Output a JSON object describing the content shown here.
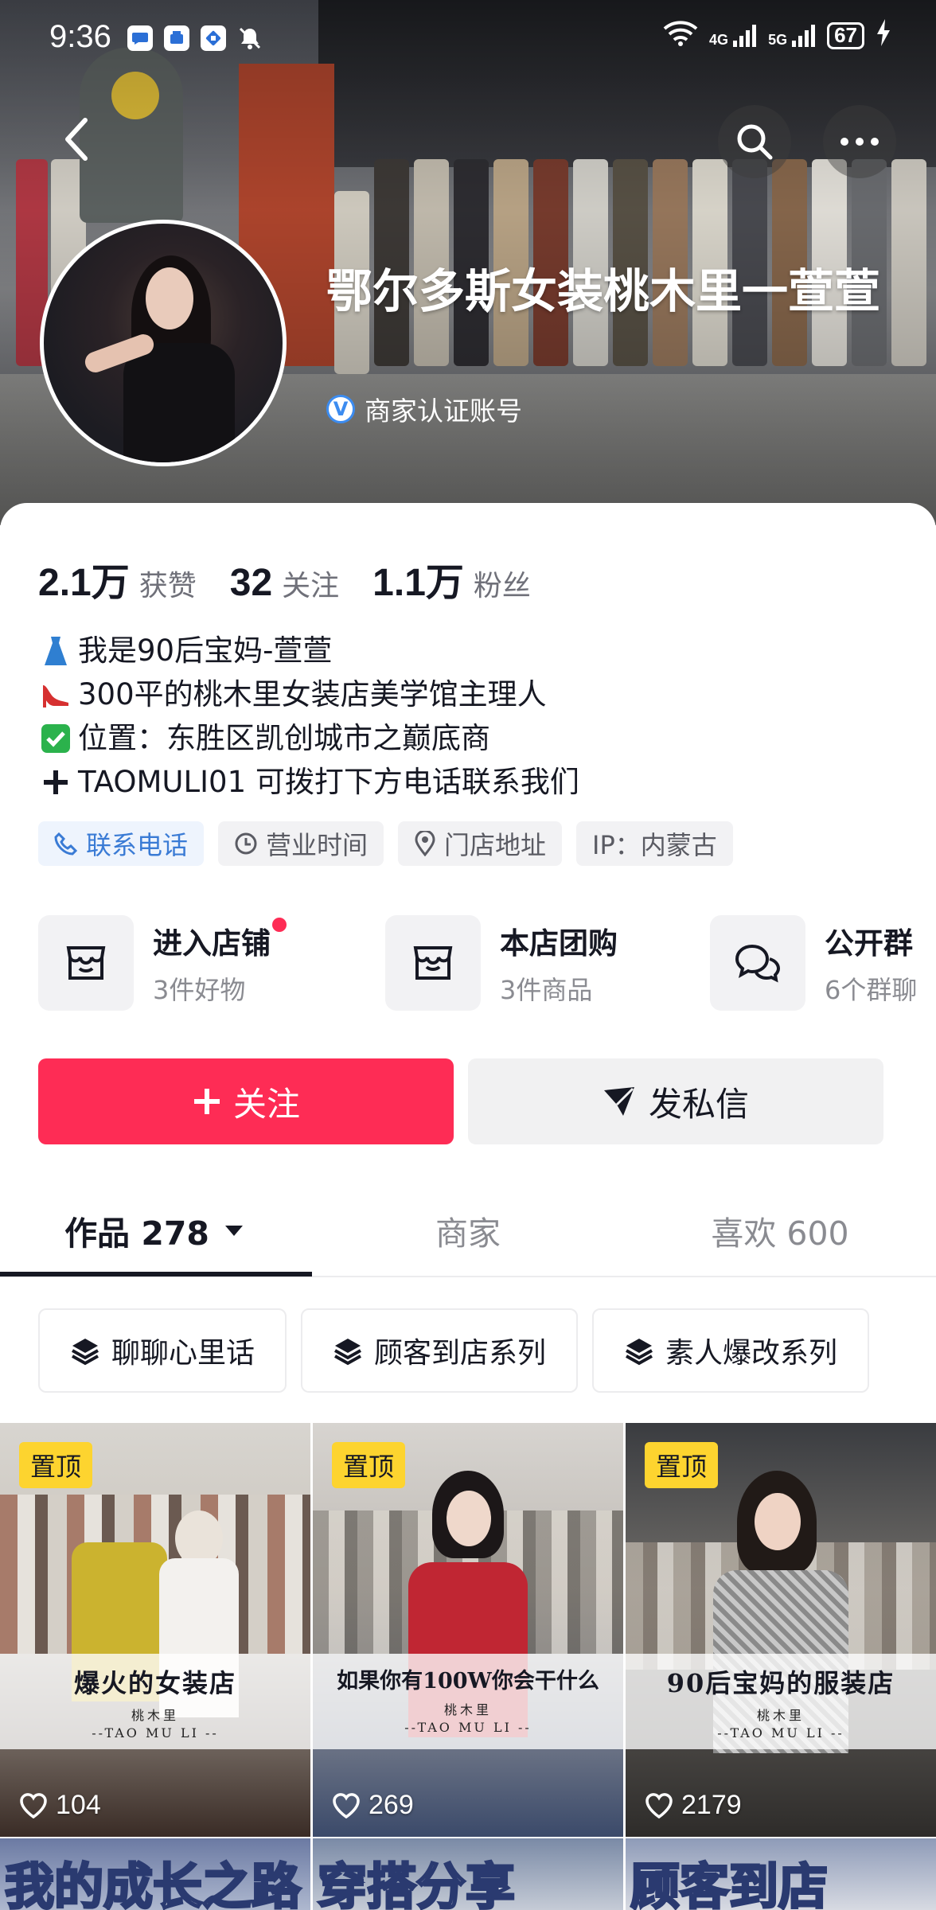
{
  "status_bar": {
    "time": "9:36",
    "network_4g": "4G",
    "network_5g": "5G",
    "battery": "67"
  },
  "profile": {
    "name": "鄂尔多斯女装桃木里一萱萱",
    "verification": "商家认证账号"
  },
  "stats": [
    {
      "value": "2.1万",
      "label": "获赞"
    },
    {
      "value": "32",
      "label": "关注"
    },
    {
      "value": "1.1万",
      "label": "粉丝"
    }
  ],
  "bio": [
    {
      "emoji": "👗",
      "text": "我是90后宝妈-萱萱"
    },
    {
      "emoji": "👠",
      "text": "300平的桃木里女装店美学馆主理人"
    },
    {
      "emoji": "✅",
      "text": "位置：东胜区凯创城市之巅底商"
    },
    {
      "emoji": "➕",
      "text": "TAOMULI01 可拨打下方电话联系我们"
    }
  ],
  "tags": [
    {
      "label": "联系电话",
      "icon": "phone-icon"
    },
    {
      "label": "营业时间",
      "icon": "clock-icon"
    },
    {
      "label": "门店地址",
      "icon": "location-pin-icon"
    },
    {
      "label": "IP：内蒙古",
      "icon": ""
    }
  ],
  "shortcuts": [
    {
      "title": "进入店铺",
      "subtitle": "3件好物",
      "icon": "shop-icon"
    },
    {
      "title": "本店团购",
      "subtitle": "3件商品",
      "icon": "group-buy-icon"
    },
    {
      "title": "公开群",
      "subtitle": "6个群聊",
      "icon": "chat-group-icon"
    }
  ],
  "actions": {
    "follow": "关注",
    "message": "发私信"
  },
  "tabs": [
    {
      "label": "作品 278"
    },
    {
      "label": "商家"
    },
    {
      "label": "喜欢 600"
    }
  ],
  "collections": [
    {
      "label": "聊聊心里话"
    },
    {
      "label": "顾客到店系列"
    },
    {
      "label": "素人爆改系列"
    }
  ],
  "videos": [
    {
      "pin": "置顶",
      "title": "爆火的女装店",
      "brand": "桃木里",
      "sub": "--TAO MU LI --",
      "likes": "104"
    },
    {
      "pin": "置顶",
      "title": "如果你有100W你会干什么",
      "brand": "桃木里",
      "sub": "--TAO MU LI --",
      "likes": "269"
    },
    {
      "pin": "置顶",
      "title": "90后宝妈的服装店",
      "brand": "桃木里",
      "sub": "--TAO MU LI --",
      "likes": "2179"
    }
  ],
  "videos_row2": [
    {
      "title": "我的成长之路"
    },
    {
      "title": "穿搭分享"
    },
    {
      "title": "顾客到店"
    }
  ],
  "colors": {
    "accent": "#fe2c55",
    "pin": "#fdd42f",
    "verify": "#3c8cf0"
  }
}
